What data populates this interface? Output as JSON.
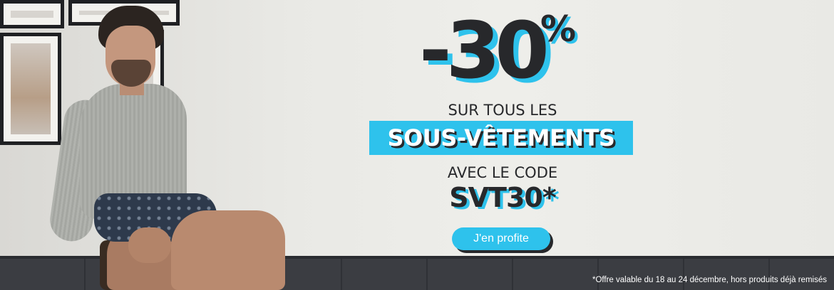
{
  "promo": {
    "discount": "-30",
    "percent": "%",
    "line1": "SUR TOUS LES",
    "highlight": "SOUS-VÊTEMENTS",
    "line2": "AVEC LE CODE",
    "code": "SVT30*"
  },
  "cta": {
    "label": "J'en profite"
  },
  "disclaimer": "*Offre valable du 18 au 24 décembre, hors produits déjà remisés",
  "colors": {
    "accent": "#2ec2ec",
    "text": "#27282b",
    "background": "#eeeeea"
  }
}
